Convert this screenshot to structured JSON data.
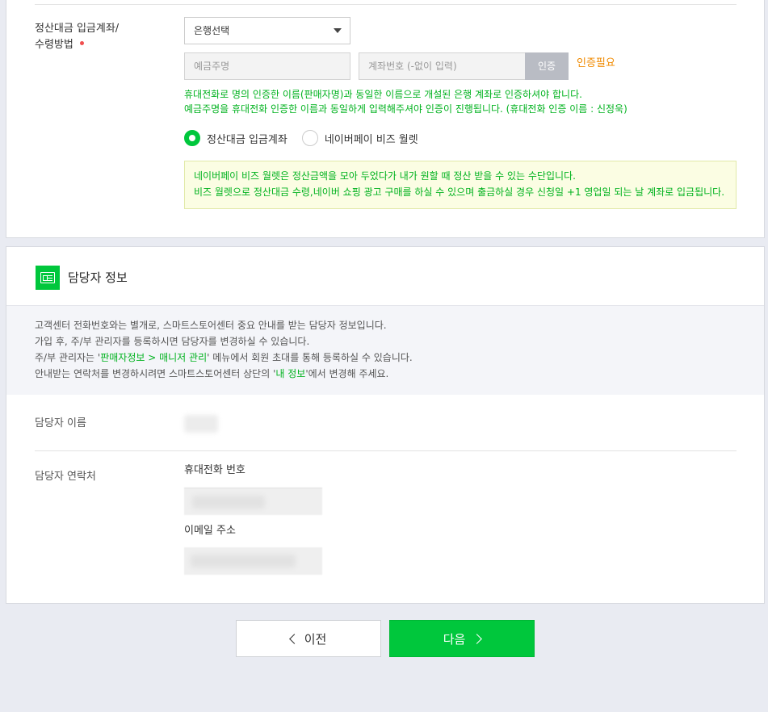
{
  "settlement": {
    "label_line1": "정산대금 입금계좌/",
    "label_line2": "수령방법",
    "bank_select": "은행선택",
    "holder_placeholder": "예금주명",
    "account_placeholder": "계좌번호 (-없이 입력)",
    "verify_button": "인증",
    "verify_status": "인증필요",
    "note_line1": "휴대전화로 명의 인증한 이름(판매자명)과 동일한 이름으로 개설된 은행 계좌로 인증하셔야 합니다.",
    "note_line2": "예금주명을 휴대전화 인증한 이름과 동일하게 입력해주셔야 인증이 진행됩니다. (휴대전화 인증 이름 : 신정욱)",
    "radio_account": "정산대금 입금계좌",
    "radio_wallet": "네이버페이 비즈 월렛",
    "wallet_info_line1": "네이버페이 비즈 월렛은 정산금액을 모아 두었다가 내가 원할 때 정산 받을 수 있는 수단입니다.",
    "wallet_info_line2": "비즈 월렛으로 정산대금 수령,네이버 쇼핑 광고 구매를 하실 수 있으며 출금하실 경우 신청일 +1 영업일 되는 날 계좌로 입금됩니다."
  },
  "manager": {
    "section_title": "담당자 정보",
    "guide_line1": "고객센터 전화번호와는 별개로, 스마트스토어센터 중요 안내를 받는 담당자 정보입니다.",
    "guide_line2": "가입 후, 주/부 관리자를 등록하시면 담당자를 변경하실 수 있습니다.",
    "guide_line3_pre": "주/부 관리자는 '",
    "guide_line3_hl": "판매자정보 > 매니저 관리",
    "guide_line3_post": "' 메뉴에서 회원 초대를 통해 등록하실 수 있습니다.",
    "guide_line4_pre": "안내받는 연락처를 변경하시려면 스마트스토어센터 상단의 '",
    "guide_line4_hl": "내 정보",
    "guide_line4_post": "'에서 변경해 주세요.",
    "name_label": "담당자 이름",
    "contact_label": "담당자 연락처",
    "phone_label": "휴대전화 번호",
    "email_label": "이메일 주소"
  },
  "footer": {
    "prev_button": "이전",
    "next_button": "다음"
  },
  "colors": {
    "accent": "#00c73c",
    "note_text": "#00b21e",
    "warning": "#f08a00",
    "required_dot": "#f04e4e"
  },
  "icons": [
    "chevron-down-icon",
    "id-card-icon",
    "chevron-left-icon",
    "chevron-right-icon"
  ]
}
